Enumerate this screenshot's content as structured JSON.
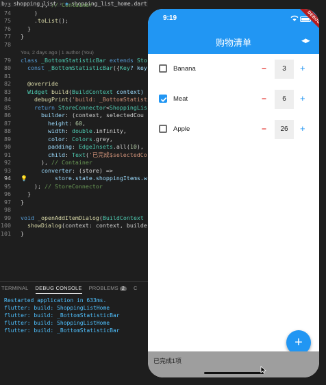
{
  "editor": {
    "breadcrumb": [
      "b",
      "shopping_list",
      "shopping_list_home.dart",
      "_P"
    ],
    "lines": [
      {
        "num": "73",
        "segs": [
          {
            "t": "      ), ",
            "c": ""
          },
          {
            "t": "// Container",
            "c": "cm"
          }
        ]
      },
      {
        "num": "74",
        "segs": [
          {
            "t": "    )",
            "c": ""
          }
        ]
      },
      {
        "num": "75",
        "segs": [
          {
            "t": "    .",
            "c": ""
          },
          {
            "t": "toList",
            "c": "fn"
          },
          {
            "t": "();",
            "c": ""
          }
        ]
      },
      {
        "num": "76",
        "segs": [
          {
            "t": "  }",
            "c": ""
          }
        ]
      },
      {
        "num": "77",
        "segs": [
          {
            "t": "}",
            "c": ""
          }
        ]
      },
      {
        "num": "78",
        "segs": []
      },
      {
        "num": "",
        "blame": "You, 2 days ago | 1 author (You)"
      },
      {
        "num": "79",
        "segs": [
          {
            "t": "class ",
            "c": "kw"
          },
          {
            "t": "_BottomStatisticBar ",
            "c": "ty"
          },
          {
            "t": "extends ",
            "c": "kw"
          },
          {
            "t": "Sto",
            "c": "ty"
          }
        ]
      },
      {
        "num": "80",
        "segs": [
          {
            "t": "  const ",
            "c": "kw"
          },
          {
            "t": "_BottomStatisticBar",
            "c": "ty"
          },
          {
            "t": "({",
            "c": ""
          },
          {
            "t": "Key",
            "c": "ty"
          },
          {
            "t": "? key",
            "c": "pr"
          }
        ]
      },
      {
        "num": "81",
        "segs": []
      },
      {
        "num": "82",
        "segs": [
          {
            "t": "  @override",
            "c": "fn"
          }
        ]
      },
      {
        "num": "83",
        "segs": [
          {
            "t": "  ",
            "c": ""
          },
          {
            "t": "Widget ",
            "c": "ty"
          },
          {
            "t": "build",
            "c": "fn"
          },
          {
            "t": "(",
            "c": ""
          },
          {
            "t": "BuildContext ",
            "c": "ty"
          },
          {
            "t": "context)",
            "c": "pr"
          }
        ]
      },
      {
        "num": "84",
        "segs": [
          {
            "t": "    ",
            "c": ""
          },
          {
            "t": "debugPrint",
            "c": "fn"
          },
          {
            "t": "(",
            "c": ""
          },
          {
            "t": "'build: _BottomStatisti",
            "c": "st"
          }
        ]
      },
      {
        "num": "85",
        "segs": [
          {
            "t": "    ",
            "c": ""
          },
          {
            "t": "return ",
            "c": "kw"
          },
          {
            "t": "StoreConnector",
            "c": "ty"
          },
          {
            "t": "<",
            "c": ""
          },
          {
            "t": "ShoppingLis",
            "c": "ty"
          }
        ]
      },
      {
        "num": "86",
        "segs": [
          {
            "t": "      ",
            "c": ""
          },
          {
            "t": "builder",
            "c": "pr"
          },
          {
            "t": ": (context, selectedCou",
            "c": ""
          }
        ]
      },
      {
        "num": "87",
        "segs": [
          {
            "t": "        ",
            "c": ""
          },
          {
            "t": "height",
            "c": "pr"
          },
          {
            "t": ": ",
            "c": ""
          },
          {
            "t": "60",
            "c": "nm"
          },
          {
            "t": ",",
            "c": ""
          }
        ]
      },
      {
        "num": "88",
        "segs": [
          {
            "t": "        ",
            "c": ""
          },
          {
            "t": "width",
            "c": "pr"
          },
          {
            "t": ": ",
            "c": ""
          },
          {
            "t": "double",
            "c": "ty"
          },
          {
            "t": ".infinity,",
            "c": ""
          }
        ]
      },
      {
        "num": "89",
        "segs": [
          {
            "t": "        ",
            "c": ""
          },
          {
            "t": "color",
            "c": "pr"
          },
          {
            "t": ": ",
            "c": ""
          },
          {
            "t": "Colors",
            "c": "ty"
          },
          {
            "t": ".grey,",
            "c": ""
          }
        ]
      },
      {
        "num": "90",
        "segs": [
          {
            "t": "        ",
            "c": ""
          },
          {
            "t": "padding",
            "c": "pr"
          },
          {
            "t": ": ",
            "c": ""
          },
          {
            "t": "EdgeInsets",
            "c": "ty"
          },
          {
            "t": ".all(",
            "c": ""
          },
          {
            "t": "10",
            "c": "nm"
          },
          {
            "t": "),",
            "c": ""
          }
        ]
      },
      {
        "num": "91",
        "segs": [
          {
            "t": "        ",
            "c": ""
          },
          {
            "t": "child",
            "c": "pr"
          },
          {
            "t": ": ",
            "c": ""
          },
          {
            "t": "Text",
            "c": "ty"
          },
          {
            "t": "(",
            "c": ""
          },
          {
            "t": "'已完成$selectedCo",
            "c": "st"
          }
        ]
      },
      {
        "num": "92",
        "segs": [
          {
            "t": "      ), ",
            "c": ""
          },
          {
            "t": "// Container",
            "c": "cm"
          }
        ]
      },
      {
        "num": "93",
        "segs": [
          {
            "t": "      ",
            "c": ""
          },
          {
            "t": "converter",
            "c": "pr"
          },
          {
            "t": ": (store) =>",
            "c": ""
          }
        ]
      },
      {
        "num": "94",
        "segs": [
          {
            "t": "          store.state.shoppingItems.w",
            "c": "pr"
          }
        ],
        "bulb": true,
        "current": true
      },
      {
        "num": "95",
        "segs": [
          {
            "t": "    ); ",
            "c": ""
          },
          {
            "t": "// StoreConnector",
            "c": "cm"
          }
        ]
      },
      {
        "num": "96",
        "segs": [
          {
            "t": "  }",
            "c": ""
          }
        ]
      },
      {
        "num": "97",
        "segs": [
          {
            "t": "}",
            "c": ""
          }
        ]
      },
      {
        "num": "98",
        "segs": []
      },
      {
        "num": "99",
        "segs": [
          {
            "t": "void ",
            "c": "kw"
          },
          {
            "t": "_openAddItemDialog",
            "c": "fn"
          },
          {
            "t": "(",
            "c": ""
          },
          {
            "t": "BuildContext",
            "c": "ty"
          }
        ]
      },
      {
        "num": "100",
        "segs": [
          {
            "t": "  ",
            "c": ""
          },
          {
            "t": "showDialog",
            "c": "fn"
          },
          {
            "t": "(context: context, builde",
            "c": ""
          }
        ]
      },
      {
        "num": "101",
        "segs": [
          {
            "t": "}",
            "c": ""
          }
        ]
      }
    ],
    "panel": {
      "tabs": [
        "TERMINAL",
        "DEBUG CONSOLE",
        "PROBLEMS",
        "C"
      ],
      "problems_count": "2",
      "console_lines": [
        "Restarted application in 633ms.",
        "flutter: build: ShoppingListHome",
        "flutter: build: _BottomStatisticBar",
        "flutter: build: ShoppingListHome",
        "flutter: build: _BottomStatisticBar"
      ]
    }
  },
  "phone": {
    "time": "9:19",
    "debug_banner": "DEBUG",
    "title": "购物清单",
    "accent": "#2196f3",
    "items": [
      {
        "name": "Banana",
        "checked": false,
        "quantity": "3"
      },
      {
        "name": "Meat",
        "checked": true,
        "quantity": "6"
      },
      {
        "name": "Apple",
        "checked": false,
        "quantity": "26"
      }
    ],
    "minus_symbol": "−",
    "plus_symbol": "+",
    "fab_symbol": "+",
    "bottom_text": "已完成1项"
  }
}
